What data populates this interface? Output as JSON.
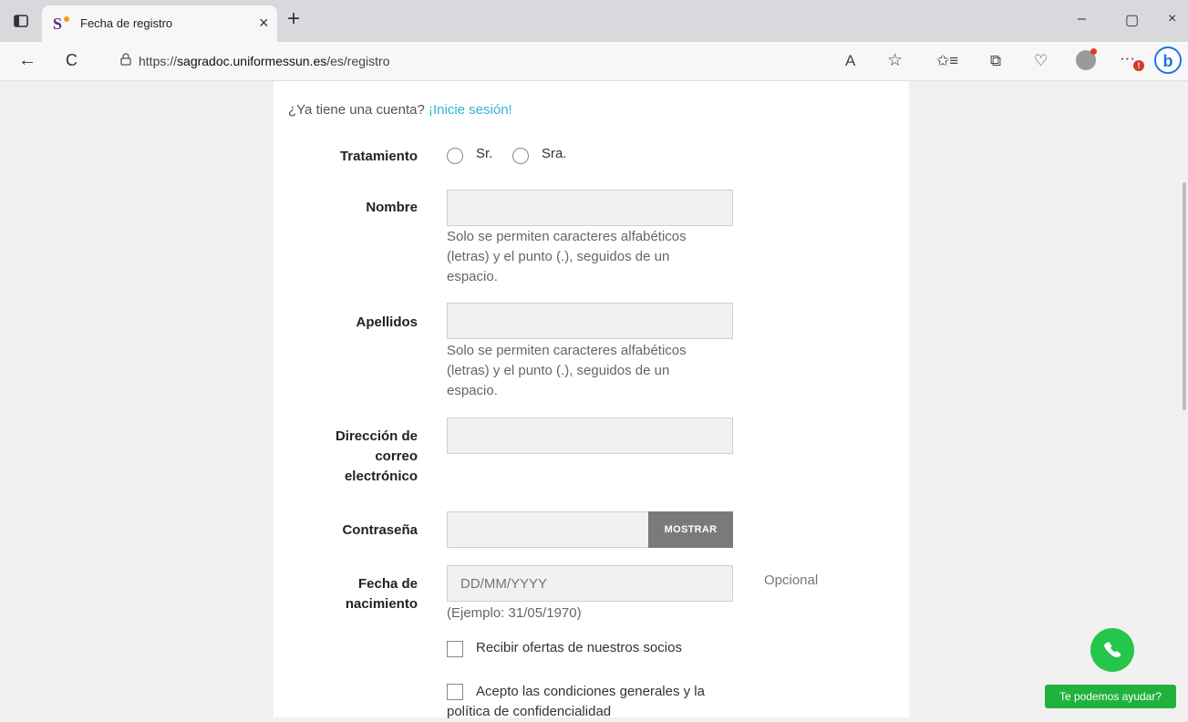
{
  "browser": {
    "tab_title": "Fecha de registro",
    "tab_close": "×",
    "new_tab": "+",
    "url_prefix": "https://",
    "url_domain": "sagradoc.uniformessun.es",
    "url_path": "/es/registro",
    "minimize": "–",
    "restore": "▢",
    "close": "×",
    "back": "←",
    "reload": "C",
    "read_aloud": "A",
    "favorite": "☆",
    "favorites_list": "✩≡",
    "collections": "⧉",
    "heart": "♡",
    "more": "···",
    "bing": "b",
    "notif_count": "!"
  },
  "form": {
    "have_account_text": "¿Ya tiene una cuenta? ",
    "login_link": "¡Inicie sesión!",
    "treatment_label": "Tratamiento",
    "treatment_options": [
      "Sr.",
      "Sra."
    ],
    "first_name_label": "Nombre",
    "first_name_hint": "Solo se permiten caracteres alfabéticos (letras) y el punto (.), seguidos de un espacio.",
    "last_name_label": "Apellidos",
    "last_name_hint": "Solo se permiten caracteres alfabéticos (letras) y el punto (.), seguidos de un espacio.",
    "email_label_1": "Dirección de",
    "email_label_2": "correo",
    "email_label_3": "electrónico",
    "password_label": "Contraseña",
    "show_button": "MOSTRAR",
    "birthdate_label_1": "Fecha de",
    "birthdate_label_2": "nacimiento",
    "birthdate_placeholder": "DD/MM/YYYY",
    "birthdate_optional": "Opcional",
    "birthdate_example": "(Ejemplo: 31/05/1970)",
    "partners_offers": "Recibir ofertas de nuestros socios",
    "accept_terms_1": "Acepto las condiciones generales y la",
    "accept_terms_2": "política de confidencialidad"
  },
  "help": {
    "whatsapp_label": "Te podemos ayudar?"
  },
  "colors": {
    "link": "#2fb5d2",
    "whatsapp": "#26c64a",
    "show_button_bg": "#7a7a7a"
  }
}
